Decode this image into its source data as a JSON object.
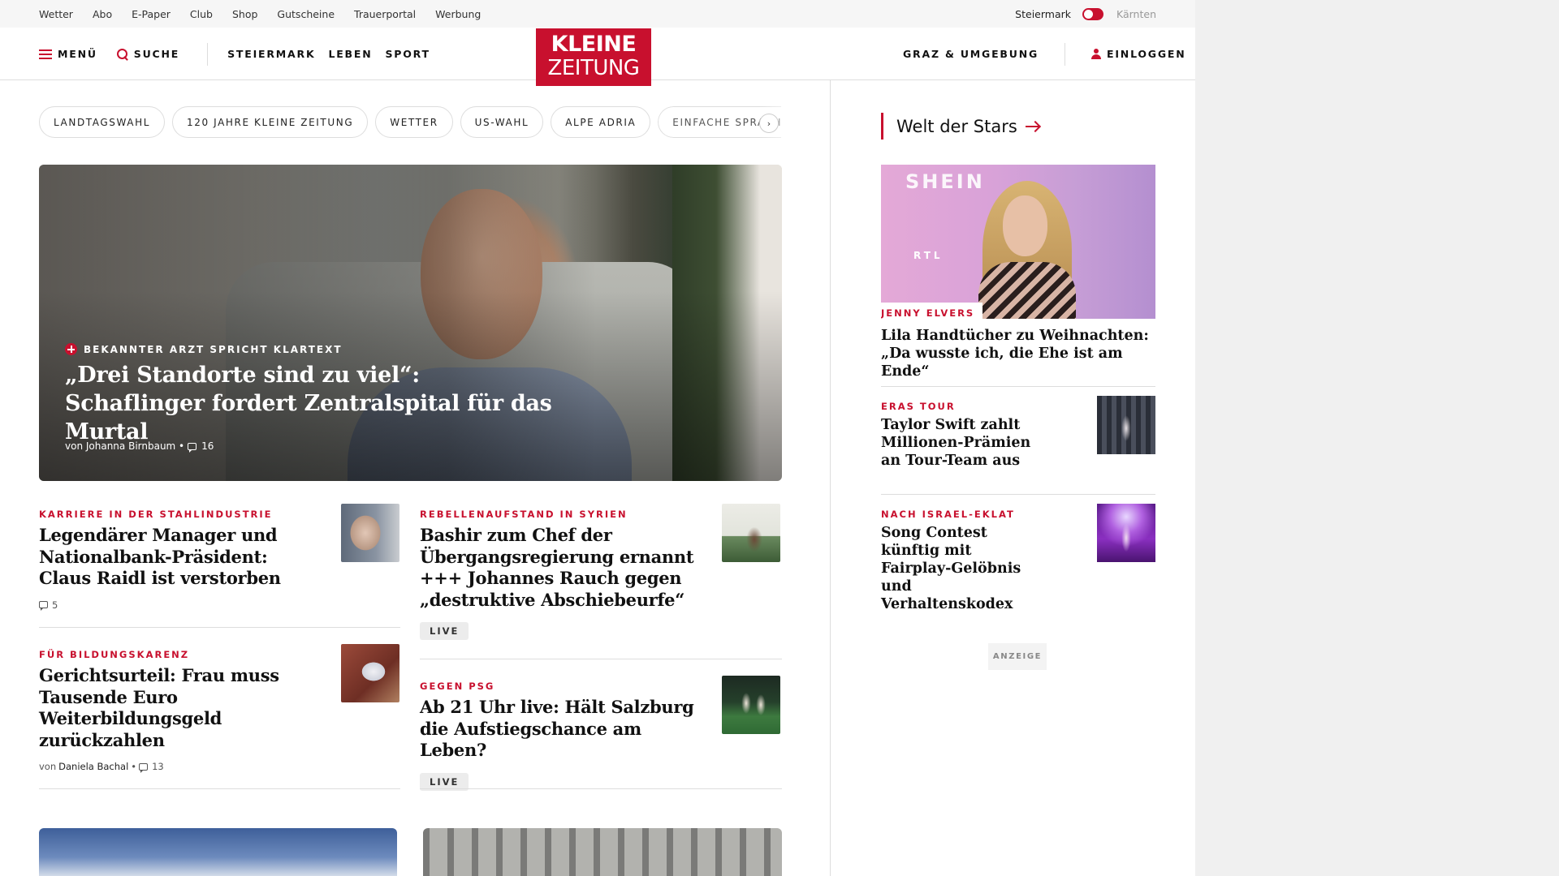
{
  "utility_bar": {
    "links": [
      "Wetter",
      "Abo",
      "E-Paper",
      "Club",
      "Shop",
      "Gutscheine",
      "Trauerportal",
      "Werbung"
    ],
    "region_active": "Steiermark",
    "region_inactive": "Kärnten"
  },
  "header": {
    "menu_label": "MENÜ",
    "search_label": "SUCHE",
    "nav": [
      "STEIERMARK",
      "LEBEN",
      "SPORT"
    ],
    "logo_line1": "KLEINE",
    "logo_line2": "ZEITUNG",
    "region_link": "GRAZ & UMGEBUNG",
    "login_label": "EINLOGGEN"
  },
  "topics": [
    "LANDTAGSWAHL",
    "120 JAHRE KLEINE ZEITUNG",
    "WETTER",
    "US-WAHL",
    "ALPE ADRIA",
    "EINFACHE SPRACHE"
  ],
  "topics_next": "›",
  "hero": {
    "kicker": "BEKANNTER ARZT SPRICHT KLARTEXT",
    "title": "„Drei Standorte sind zu viel“: Schaflinger fordert Zentralspital für das Murtal",
    "byline": "von Johanna Birnbaum •",
    "comments": "16"
  },
  "teasers": [
    {
      "kicker": "KARRIERE IN DER STAHLINDUSTRIE",
      "title": "Legendärer Manager und Nationalbank-Präsident: Claus Raidl ist verstorben",
      "comments": "5"
    },
    {
      "kicker": "REBELLENAUFSTAND IN SYRIEN",
      "title": "Bashir zum Chef der Übergangsregierung ernannt +++ Johannes Rauch gegen „destruktive Abschiebeurfe“",
      "badge": "LIVE"
    },
    {
      "kicker": "FÜR BILDUNGSKARENZ",
      "title": "Gerichtsurteil: Frau muss Tausende Euro Weiterbildungsgeld zurückzahlen",
      "byline_prefix": "von",
      "author": "Daniela Bachal",
      "sep": "•",
      "comments": "13"
    },
    {
      "kicker": "GEGEN PSG",
      "title": "Ab 21 Uhr live: Hält Salzburg die Aufstiegschance am Leben?",
      "badge": "LIVE"
    }
  ],
  "sidebar": {
    "section_title": "Welt der Stars",
    "lead": {
      "image_text": "SHEIN",
      "image_text2": "RTL",
      "kicker": "JENNY ELVERS",
      "title": "Lila Handtücher zu Weihnachten: „Da wusste ich, die Ehe ist am Ende“"
    },
    "items": [
      {
        "kicker": "ERAS TOUR",
        "title": "Taylor Swift zahlt Millionen-Prämien an Tour-Team aus"
      },
      {
        "kicker": "NACH ISRAEL-EKLAT",
        "title": "Song Contest künftig mit Fairplay-Gelöbnis und Verhaltenskodex"
      }
    ],
    "ad_label": "ANZEIGE"
  },
  "colors": {
    "brand_red": "#c8102e"
  }
}
